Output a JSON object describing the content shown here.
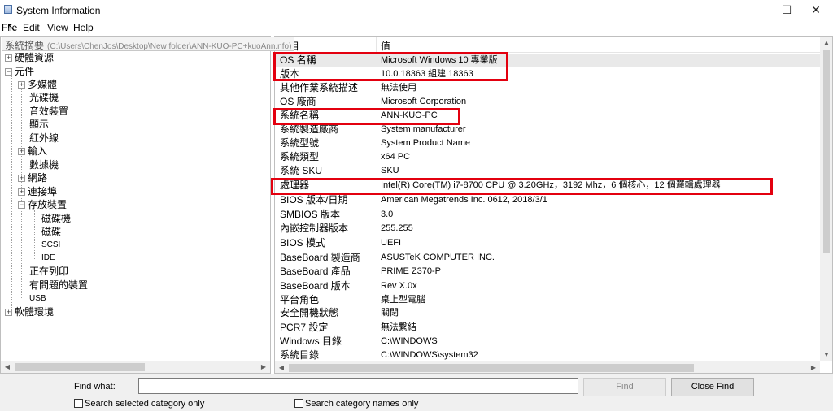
{
  "window": {
    "title": "System Information",
    "minimize": "—",
    "maximize": "☐",
    "close": "✕"
  },
  "menu": {
    "file": "File",
    "edit": "Edit",
    "view": "View",
    "help": "Help"
  },
  "tooltip": {
    "label": "系統摘要",
    "path": "(C:\\Users\\ChenJos\\Desktop\\New folder\\ANN-KUO-PC+kuoAnn.nfo)"
  },
  "tree": [
    {
      "label": "硬體資源",
      "expander": "+"
    },
    {
      "label": "元件",
      "expander": "−"
    },
    {
      "label": "多媒體",
      "expander": "+"
    },
    {
      "label": "光碟機"
    },
    {
      "label": "音效裝置"
    },
    {
      "label": "顯示"
    },
    {
      "label": "紅外線"
    },
    {
      "label": "輸入",
      "expander": "+"
    },
    {
      "label": "數據機"
    },
    {
      "label": "網路",
      "expander": "+"
    },
    {
      "label": "連接埠",
      "expander": "+"
    },
    {
      "label": "存放裝置",
      "expander": "−"
    },
    {
      "label": "磁碟機"
    },
    {
      "label": "磁碟"
    },
    {
      "label": "SCSI"
    },
    {
      "label": "IDE"
    },
    {
      "label": "正在列印"
    },
    {
      "label": "有問題的裝置"
    },
    {
      "label": "USB"
    },
    {
      "label": "軟體環境",
      "expander": "+"
    }
  ],
  "details": {
    "col_item": "項目",
    "col_value": "值",
    "rows": [
      {
        "item": "OS 名稱",
        "value": "Microsoft Windows 10 專業版"
      },
      {
        "item": "版本",
        "value": "10.0.18363 組建 18363"
      },
      {
        "item": "其他作業系統描述",
        "value": "無法使用"
      },
      {
        "item": "OS 廠商",
        "value": "Microsoft Corporation"
      },
      {
        "item": "系統名稱",
        "value": "ANN-KUO-PC"
      },
      {
        "item": "系統製造廠商",
        "value": "System manufacturer"
      },
      {
        "item": "系統型號",
        "value": "System Product Name"
      },
      {
        "item": "系統類型",
        "value": "x64 PC"
      },
      {
        "item": "系統 SKU",
        "value": "SKU"
      },
      {
        "item": "處理器",
        "value": "Intel(R) Core(TM) i7-8700 CPU @ 3.20GHz，3192 Mhz，6 個核心，12 個邏輯處理器"
      },
      {
        "item": "BIOS 版本/日期",
        "value": "American Megatrends Inc. 0612, 2018/3/1"
      },
      {
        "item": "SMBIOS 版本",
        "value": "3.0"
      },
      {
        "item": "內嵌控制器版本",
        "value": "255.255"
      },
      {
        "item": "BIOS 模式",
        "value": "UEFI"
      },
      {
        "item": "BaseBoard 製造商",
        "value": "ASUSTeK COMPUTER INC."
      },
      {
        "item": "BaseBoard 產品",
        "value": "PRIME Z370-P"
      },
      {
        "item": "BaseBoard 版本",
        "value": "Rev X.0x"
      },
      {
        "item": "平台角色",
        "value": "桌上型電腦"
      },
      {
        "item": "安全開機狀態",
        "value": "關閉"
      },
      {
        "item": "PCR7 設定",
        "value": "無法繫結"
      },
      {
        "item": "Windows 目錄",
        "value": "C:\\WINDOWS"
      },
      {
        "item": "系統目錄",
        "value": "C:\\WINDOWS\\system32"
      }
    ]
  },
  "find": {
    "label": "Find what:",
    "value": "",
    "find_button": "Find",
    "close_button": "Close Find",
    "search_selected": "Search selected category only",
    "search_names": "Search category names only"
  },
  "colors": {
    "highlight_box": "#e3000f",
    "selected_row": "#e9e9e9"
  }
}
